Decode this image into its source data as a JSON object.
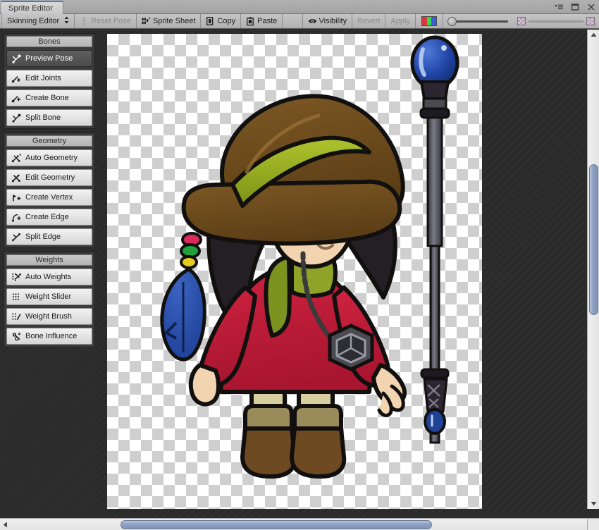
{
  "window": {
    "tab_label": "Sprite Editor",
    "controls": [
      {
        "name": "menu-icon",
        "label": "≡"
      },
      {
        "name": "maximize-icon",
        "label": "□"
      },
      {
        "name": "close-icon",
        "label": "✕"
      }
    ]
  },
  "toolbar": {
    "mode_dropdown": "Skinning Editor",
    "mode_dropdown_arrow": "⇅",
    "reset_pose": "Reset Pose",
    "sprite_sheet": "Sprite Sheet",
    "copy": "Copy",
    "paste": "Paste",
    "visibility": "Visibility",
    "revert": "Revert",
    "apply": "Apply",
    "channel_button_name": "rgb-channel-button",
    "zoom_slider_value": 0,
    "alpha_slider_value": 100
  },
  "panels": [
    {
      "title": "Bones",
      "buttons": [
        {
          "label": "Preview Pose",
          "icon": "preview-pose-icon",
          "active": true
        },
        {
          "label": "Edit Joints",
          "icon": "edit-joints-icon",
          "active": false
        },
        {
          "label": "Create Bone",
          "icon": "create-bone-icon",
          "active": false
        },
        {
          "label": "Split Bone",
          "icon": "split-bone-icon",
          "active": false
        }
      ]
    },
    {
      "title": "Geometry",
      "buttons": [
        {
          "label": "Auto Geometry",
          "icon": "auto-geometry-icon",
          "active": false
        },
        {
          "label": "Edit Geometry",
          "icon": "edit-geometry-icon",
          "active": false
        },
        {
          "label": "Create Vertex",
          "icon": "create-vertex-icon",
          "active": false
        },
        {
          "label": "Create Edge",
          "icon": "create-edge-icon",
          "active": false
        },
        {
          "label": "Split Edge",
          "icon": "split-edge-icon",
          "active": false
        }
      ]
    },
    {
      "title": "Weights",
      "buttons": [
        {
          "label": "Auto Weights",
          "icon": "auto-weights-icon",
          "active": false
        },
        {
          "label": "Weight Slider",
          "icon": "weight-slider-icon",
          "active": false
        },
        {
          "label": "Weight Brush",
          "icon": "weight-brush-icon",
          "active": false
        },
        {
          "label": "Bone Influence",
          "icon": "bone-influence-icon",
          "active": false
        }
      ]
    }
  ],
  "canvas": {
    "sprite_name": "mage-character-sprite",
    "secondary_sprite_name": "magic-staff-sprite",
    "background": "transparent-checkerboard"
  },
  "colors": {
    "hat_brown": "#6b4a1e",
    "hat_band_green": "#9ab022",
    "robe_red": "#c21f3a",
    "scarf_green": "#7c9320",
    "eye_purple": "#8b2fc9",
    "skin": "#f2d5b0",
    "hair_black": "#241f24",
    "boot_brown": "#6d4a22",
    "pants_tan": "#d8cfa0",
    "staff_blue": "#1b3f96",
    "staff_shaft": "#4a4a50",
    "accent_blue": "#4a77c6",
    "toolbar_bg": "#b8b8b8",
    "panel_bg": "#3b3b3b",
    "app_bg": "#2d2d2d"
  },
  "scrollbars": {
    "vertical_thumb_position_pct": 27,
    "vertical_thumb_size_pct": 33,
    "horizontal_thumb_position_pct": 19,
    "horizontal_thumb_size_pct": 54
  }
}
